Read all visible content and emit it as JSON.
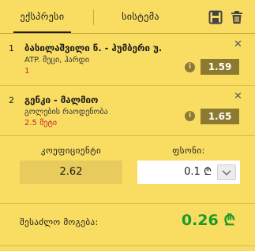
{
  "tabs": [
    {
      "label": "ექსპრესი",
      "active": true
    },
    {
      "label": "სისტემა",
      "active": false
    }
  ],
  "icons": {
    "save": "save-icon",
    "trash": "trash-icon"
  },
  "bets": [
    {
      "index": "1",
      "title": "ბასილაშვილი ნ. - ჰუმბერი უ.",
      "market": "ATP. მეცი, ჰარდი",
      "selection": "1",
      "odds": "1.59"
    },
    {
      "index": "2",
      "title": "გენკი - მალმიო",
      "market": "გოლების რაოდენობა",
      "selection": "2.5 მეტი",
      "odds": "1.65"
    }
  ],
  "calc": {
    "coef_label": "კოეფიციენტი",
    "coef_value": "2.62",
    "stake_label": "ფსონი:",
    "stake_value": "0.1 ₾"
  },
  "total": {
    "label": "შესაძლო მოგება:",
    "value": "0.26 ₾"
  },
  "colors": {
    "background": "#f9dd63",
    "odds_box": "#8b7a2f",
    "win_value": "#1a9a2a",
    "selection_text": "#c0272d"
  }
}
